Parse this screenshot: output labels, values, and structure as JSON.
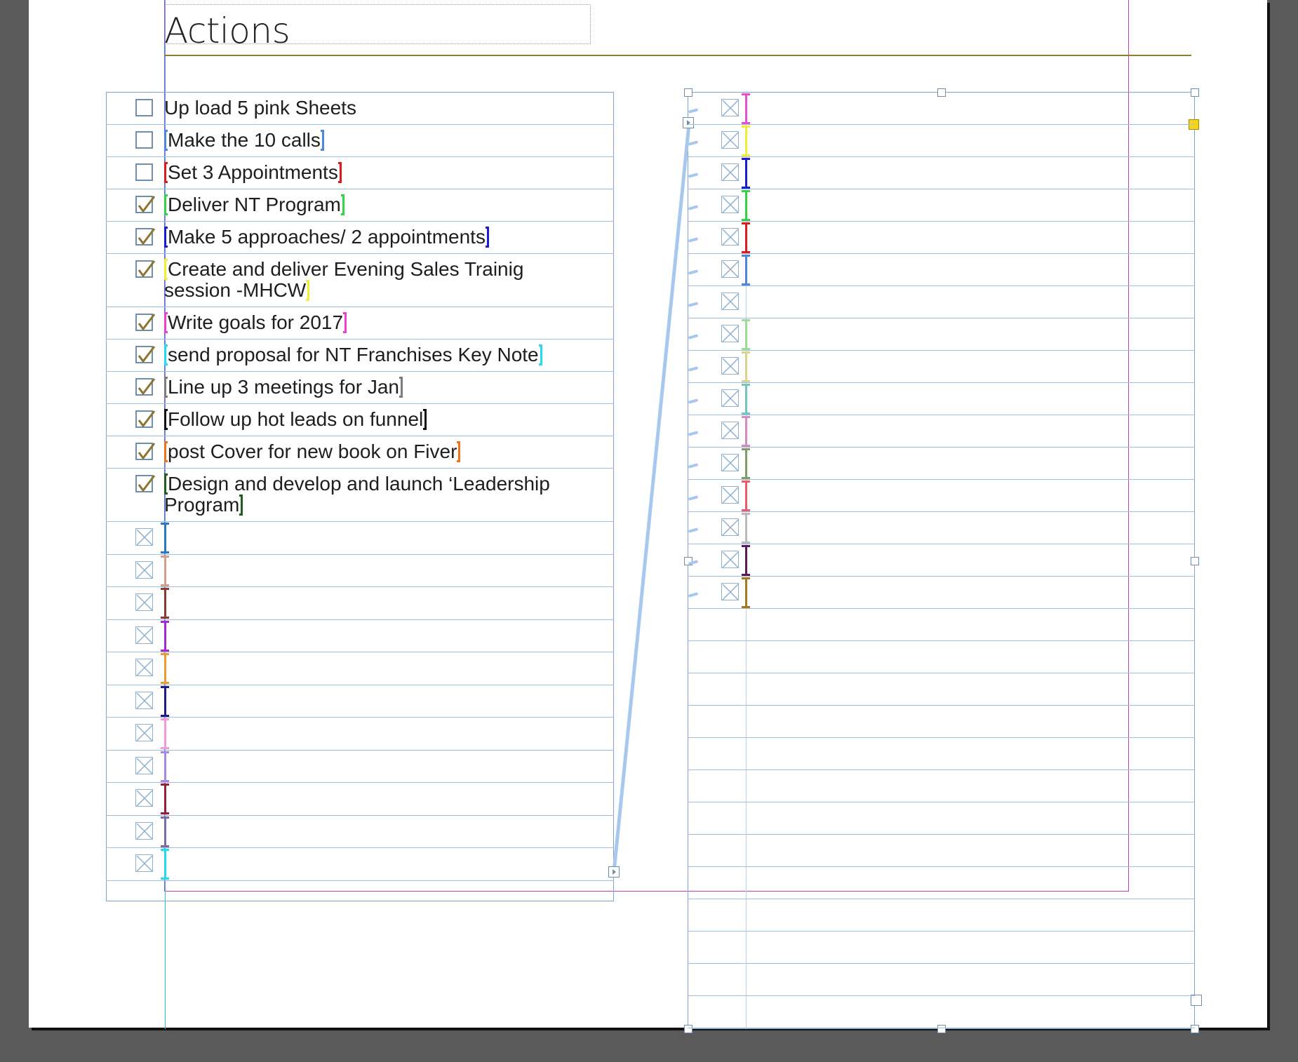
{
  "page_title": "Actions",
  "colors": {
    "pasteboard": "#5a5a5a",
    "page": "#ffffff",
    "frame_border": "#7da3cf",
    "row_line": "#9fc0e0",
    "title_rule": "#8c7f2f",
    "margin_guide": "#c13dc1",
    "column_guide": "#19c6d8",
    "check_mark": "#8c7530",
    "text_thread": "#a8c8ef",
    "overflow_port": "#f4d41d"
  },
  "left_frame": {
    "tasks": [
      {
        "label": "Up load 5 pink Sheets",
        "checked": false,
        "tag_color": ""
      },
      {
        "label": "Make the 10 calls",
        "checked": false,
        "tag_color": "#4f84e0"
      },
      {
        "label": "Set 3 Appointments",
        "checked": false,
        "tag_color": "#e0191f"
      },
      {
        "label": "Deliver NT Program",
        "checked": true,
        "tag_color": "#2fd44b"
      },
      {
        "label": "Make 5 approaches/ 2 appointments",
        "checked": true,
        "tag_color": "#1b1bd6"
      },
      {
        "label": "Create and deliver Evening Sales Trainig",
        "label2": "session  -MHCW",
        "checked": true,
        "tag_color": "#f1ee34"
      },
      {
        "label": "Write goals for 2017",
        "checked": true,
        "tag_color": "#f03fcf"
      },
      {
        "label": "send proposal for NT Franchises Key Note",
        "checked": true,
        "tag_color": "#25d9ee"
      },
      {
        "label": "Line up 3 meetings for Jan",
        "checked": true,
        "tag_color": "#7d7d7d"
      },
      {
        "label": "Follow up hot leads on funnel",
        "checked": true,
        "tag_color": "#111111"
      },
      {
        "label": "post Cover for new book on Fiver",
        "checked": true,
        "tag_color": "#f0731c"
      },
      {
        "label": "Design and develop and launch ‘Leadership",
        "label2": "Program",
        "checked": true,
        "tag_color": "#1f5e1c"
      }
    ],
    "placeholder_rows": [
      {
        "tag_color": "#2678c8"
      },
      {
        "tag_color": "#d29e8e"
      },
      {
        "tag_color": "#8a3a32"
      },
      {
        "tag_color": "#a32ad6"
      },
      {
        "tag_color": "#ee9a2c"
      },
      {
        "tag_color": "#1d1d8a"
      },
      {
        "tag_color": "#f59ad6"
      },
      {
        "tag_color": "#a788e6"
      },
      {
        "tag_color": "#9a1d36"
      },
      {
        "tag_color": "#7d6aa8"
      },
      {
        "tag_color": "#25d9ee"
      }
    ]
  },
  "right_frame": {
    "placeholder_rows": [
      {
        "tag_color": "#e84fd6"
      },
      {
        "tag_color": "#f1ee34"
      },
      {
        "tag_color": "#1b1bd6"
      },
      {
        "tag_color": "#2fd44b"
      },
      {
        "tag_color": "#e0191f"
      },
      {
        "tag_color": "#4f84e0"
      },
      {
        "tag_color": ""
      },
      {
        "tag_color": "#9edb94"
      },
      {
        "tag_color": "#dbd48a"
      },
      {
        "tag_color": "#6fc7bf"
      },
      {
        "tag_color": "#d888c2"
      },
      {
        "tag_color": "#7f9d66"
      },
      {
        "tag_color": "#ee5a6a"
      },
      {
        "tag_color": "#b9b9b9"
      },
      {
        "tag_color": "#5a1a5e"
      },
      {
        "tag_color": "#a8761c"
      }
    ]
  }
}
